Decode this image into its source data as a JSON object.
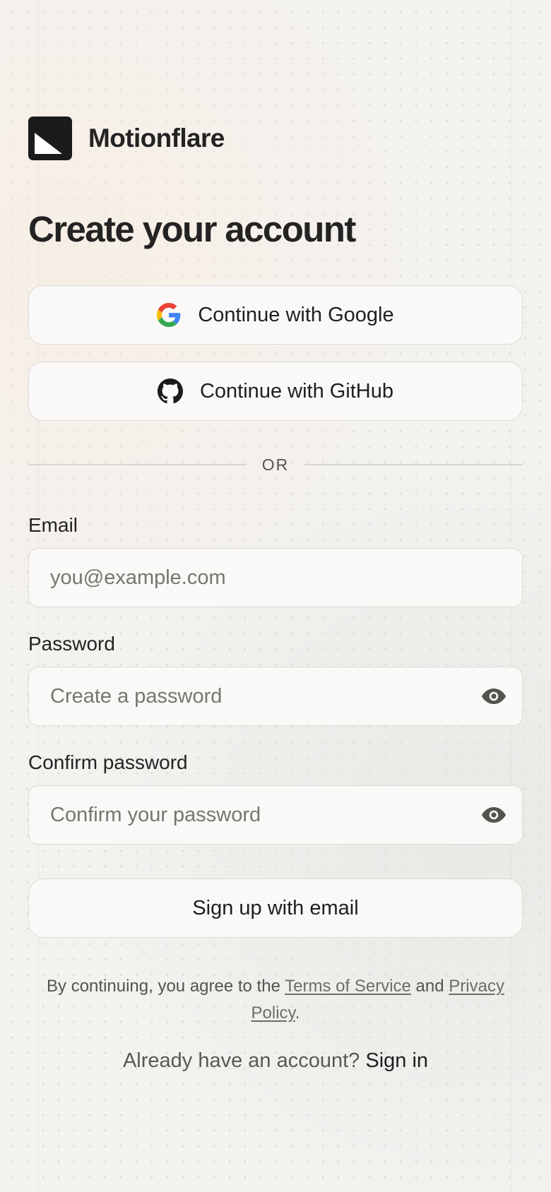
{
  "brand": {
    "name": "Motionflare",
    "logo_icon": "motionflare-logo-icon"
  },
  "page": {
    "title": "Create your account"
  },
  "oauth": {
    "google_label": "Continue with Google",
    "google_icon": "google-icon",
    "github_label": "Continue with GitHub",
    "github_icon": "github-icon"
  },
  "divider": {
    "text": "OR"
  },
  "form": {
    "email": {
      "label": "Email",
      "placeholder": "you@example.com",
      "value": ""
    },
    "password": {
      "label": "Password",
      "placeholder": "Create a password",
      "value": "",
      "toggle_icon": "eye-icon"
    },
    "confirm": {
      "label": "Confirm password",
      "placeholder": "Confirm your password",
      "value": "",
      "toggle_icon": "eye-icon"
    },
    "submit_label": "Sign up with email"
  },
  "terms": {
    "prefix": "By continuing, you agree to the ",
    "terms_link": "Terms of Service",
    "middle": " and ",
    "privacy_link": "Privacy Policy",
    "suffix": "."
  },
  "signin": {
    "prompt": "Already have an account? ",
    "link": "Sign in"
  },
  "colors": {
    "background": "#f3f2ef",
    "surface": "#faf9f7",
    "border": "#dcdad6",
    "text": "#232323",
    "muted": "#555350",
    "google_blue": "#4285F4",
    "google_red": "#EA4335",
    "google_yellow": "#FBBC05",
    "google_green": "#34A853"
  }
}
